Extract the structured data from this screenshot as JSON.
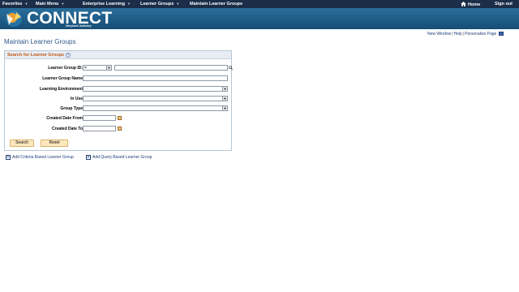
{
  "nav": {
    "items": [
      "Favorites",
      "Main Menu",
      "Enterprise Learning",
      "Learner Groups",
      "Maintain Learner Groups"
    ],
    "home": "Home",
    "signout": "Sign out"
  },
  "banner": {
    "brand": "CONNECT",
    "subtitle": "Maryland Judiciary"
  },
  "util": {
    "new_window": "New Window",
    "help": "Help",
    "personalize": "Personalize Page"
  },
  "page_title": "Maintain Learner Groups",
  "panel": {
    "title": "Search for Learner Groups",
    "help": "?",
    "fields": {
      "group_id_label": "Learner Group ID:",
      "group_id_operator": "=",
      "group_id_value": "",
      "group_name_label": "Learner Group Name",
      "group_name_value": "",
      "learning_env_label": "Learning Environment",
      "learning_env_value": "",
      "in_use_label": "In Use",
      "in_use_value": "",
      "group_type_label": "Group Type",
      "group_type_value": "",
      "created_from_label": "Created Date From",
      "created_from_value": "",
      "created_to_label": "Created Date To",
      "created_to_value": ""
    },
    "search_button": "Search",
    "reset_button": "Reset"
  },
  "add_links": {
    "criteria": "Add Criteria Based Learner Group",
    "query": "Add Query Based Learner Group"
  },
  "colors": {
    "nav_bg": "#1b2d48",
    "banner_bg": "#1f5f8b",
    "title": "#2d5a8c",
    "panel_title": "#c25a16",
    "button_bg": "#fde8bd"
  }
}
